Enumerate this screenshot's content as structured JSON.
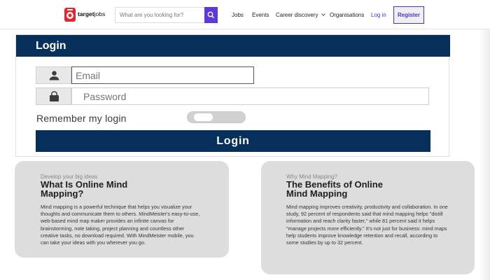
{
  "header": {
    "brand": {
      "name_bold": "target",
      "name_rest": "jobs",
      "icon": "target-logo-icon",
      "accent": "#e3262d"
    },
    "search": {
      "placeholder": "What are you looking for?",
      "button_icon": "search-icon",
      "button_color": "#5d38dc"
    },
    "nav": [
      {
        "label": "Jobs"
      },
      {
        "label": "Events"
      },
      {
        "label": "Career discovery",
        "icon": "chevron-down-icon"
      },
      {
        "label": "Organisations"
      },
      {
        "label": "Log in"
      }
    ],
    "register_label": "Register"
  },
  "login": {
    "title": "Login",
    "email": {
      "placeholder": "Email",
      "icon": "user-icon"
    },
    "password": {
      "placeholder": "Password",
      "icon": "lock-icon"
    },
    "remember_label": "Remember my login",
    "remember_enabled": false,
    "submit_label": "Login",
    "accent": "#072f5b"
  },
  "cards": [
    {
      "eyebrow": "Develop your big ideas",
      "title_lines": [
        "What Is Online Mind",
        "Mapping?"
      ],
      "body": "Mind mapping is a powerful technique that helps you visualize your thoughts and communicate them to others. MindMeister's easy-to-use, web-based mind map maker provides an infinite canvas for brainstorming, note taking, project planning and countless other creative tasks, no download required. With MindMeister mobile, you can take your ideas with you wherever you go."
    },
    {
      "eyebrow": "Why Mind Mapping?",
      "title_lines": [
        "The Benefits of Online",
        "Mind Mapping"
      ],
      "body": "Mind mapping improves creativity, productivity and collaboration. In one study, 92 percent of respondents said that mind mapping helps \"distill information and reach clarity faster,\" while 81 percent said it helps \"manage projects more efficiently.\" It's not just for business: mind maps help students improve knowledge retention and recall, according to some studies by up to 32 percent."
    }
  ]
}
